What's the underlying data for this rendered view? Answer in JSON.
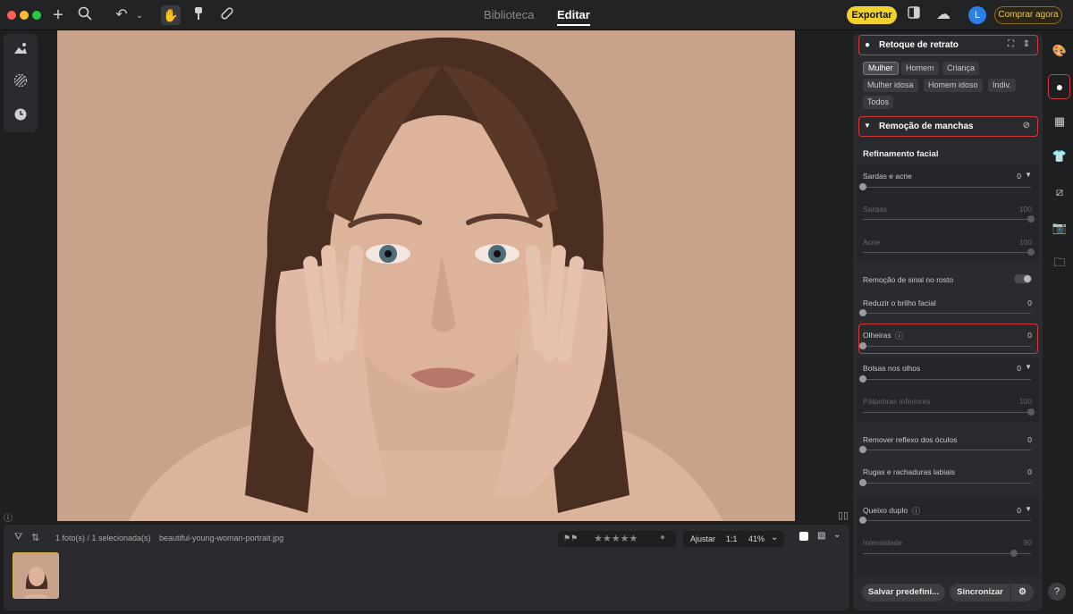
{
  "topbar": {
    "tabs": [
      "Biblioteca",
      "Editar"
    ],
    "active_tab": "Editar",
    "export_label": "Exportar",
    "buy_label": "Comprar agora",
    "avatar_letter": "L"
  },
  "filmstrip": {
    "count_text": "1 foto(s) / 1 selecionada(s)",
    "filename": "beautiful-young-woman-portrait.jpg",
    "fit_label": "Ajustar",
    "ratio_label": "1:1",
    "zoom_label": "41%"
  },
  "panel": {
    "portrait_title": "Retoque de retrato",
    "presets": [
      "Mulher",
      "Homem",
      "Criança",
      "Mulher idosa",
      "Homem idoso",
      "Indiv.",
      "Todos"
    ],
    "active_preset": "Mulher",
    "blemish_title": "Remoção de manchas",
    "refine_title": "Refinamento facial",
    "sliders": [
      {
        "label": "Sardas e acne",
        "value": "0",
        "dropdown": true,
        "dim": false
      },
      {
        "label": "Sardas",
        "value": "100",
        "dim": true
      },
      {
        "label": "Acne",
        "value": "100",
        "dim": true
      },
      {
        "label": "Remoção de sinal no rosto",
        "toggle": true
      },
      {
        "label": "Reduzir o brilho facial",
        "value": "0",
        "dim": false
      },
      {
        "label": "Olheiras",
        "value": "0",
        "dim": false,
        "info": true
      },
      {
        "label": "Bolsas nos olhos",
        "value": "0",
        "dropdown": true,
        "dim": false
      },
      {
        "label": "Pálpebras inferiores",
        "value": "100",
        "dim": true
      },
      {
        "label": "Remover reflexo dos óculos",
        "value": "0",
        "dim": false
      },
      {
        "label": "Rugas e rachaduras labiais",
        "value": "0",
        "dim": false
      },
      {
        "label": "Queixo duplo",
        "value": "0",
        "dropdown": true,
        "dim": false,
        "info": true
      },
      {
        "label": "Intensidade",
        "value": "90",
        "dim": true
      }
    ],
    "save_preset_label": "Salvar predefini...",
    "sync_label": "Sincronizar"
  },
  "colors": {
    "accent": "#f2d22a",
    "highlight": "#d13a3a"
  }
}
